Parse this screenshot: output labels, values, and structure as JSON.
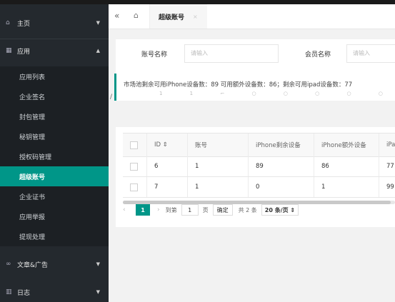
{
  "sidebar": {
    "groups": [
      {
        "icon": "home-icon",
        "label": "主页"
      },
      {
        "icon": "app-icon",
        "label": "应用"
      },
      {
        "icon": "link-icon",
        "label": "文章&广告"
      },
      {
        "icon": "log-icon",
        "label": "日志"
      }
    ],
    "items": [
      {
        "label": "应用列表"
      },
      {
        "label": "企业签名"
      },
      {
        "label": "封包管理"
      },
      {
        "label": "秘钥管理"
      },
      {
        "label": "授权码管理"
      },
      {
        "label": "超级账号"
      },
      {
        "label": "企业证书"
      },
      {
        "label": "应用举报"
      },
      {
        "label": "提现处理"
      }
    ],
    "active_item": "超级账号"
  },
  "tabbar": {
    "back_icon": "«",
    "home_icon": "⌂",
    "active_tab": "超级账号",
    "close_icon": "×"
  },
  "filter": {
    "account_label": "账号名称",
    "account_placeholder": "请输入",
    "member_label": "会员名称",
    "member_placeholder": "请输入"
  },
  "notice": {
    "text": "市场池剩余可用iPhone设备数：89 可用额外设备数：86；剩余可用ipad设备数：77"
  },
  "table": {
    "columns": [
      "",
      "ID ⇕",
      "账号",
      "iPhone剩余设备",
      "iPhone额外设备",
      "iPa"
    ],
    "rows": [
      [
        "",
        "6",
        "1",
        "89",
        "86",
        "77"
      ],
      [
        "",
        "7",
        "1",
        "0",
        "1",
        "99"
      ]
    ]
  },
  "pager": {
    "prev": "‹",
    "current": "1",
    "next": "›",
    "goto_label": "到第",
    "goto_value": "1",
    "page_unit": "页",
    "confirm": "确定",
    "total": "共 2 条",
    "page_size": "20 条/页 ⇕"
  },
  "colors": {
    "accent": "#009688",
    "sidebar_bg": "#24292e"
  }
}
